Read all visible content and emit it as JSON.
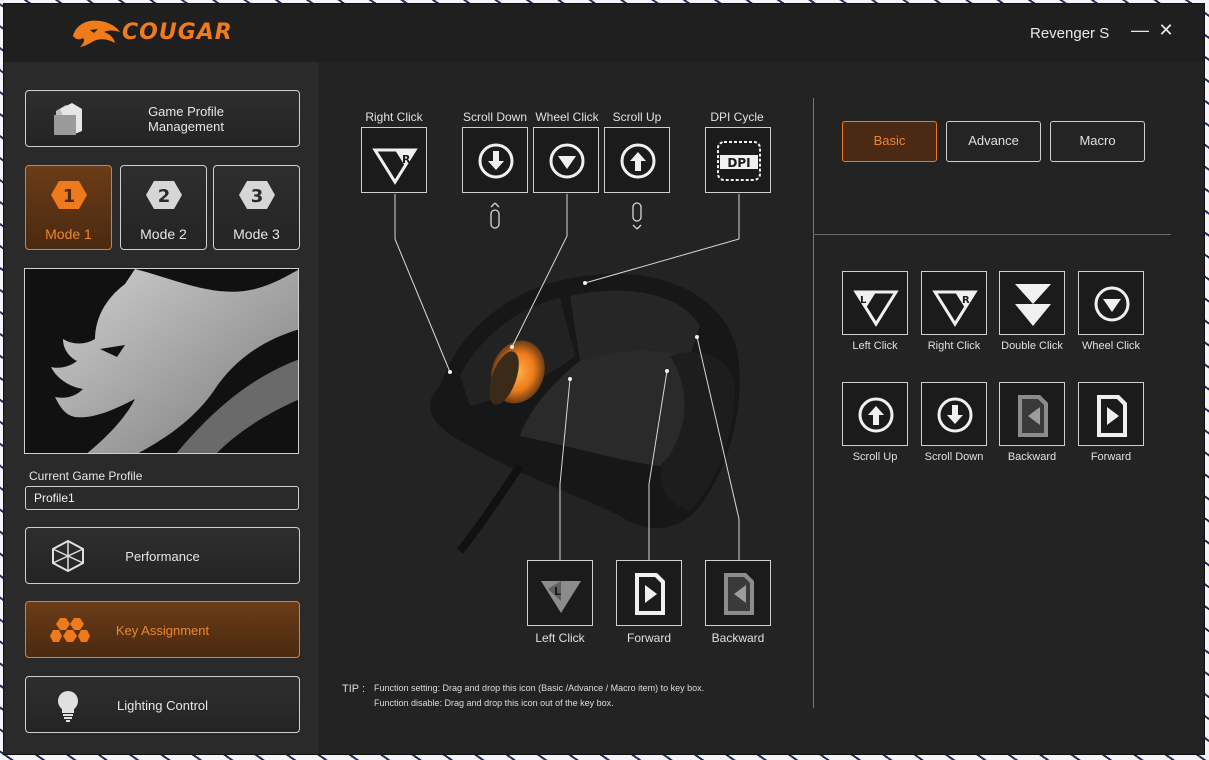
{
  "app": {
    "brand": "COUGAR",
    "device": "Revenger S",
    "minimize_glyph": "—",
    "close_glyph": "✕"
  },
  "sidebar": {
    "profile_mgmt_label": "Game Profile Management",
    "modes": [
      {
        "num": "1",
        "label": "Mode 1",
        "active": true
      },
      {
        "num": "2",
        "label": "Mode 2",
        "active": false
      },
      {
        "num": "3",
        "label": "Mode 3",
        "active": false
      }
    ],
    "current_profile_label": "Current Game Profile",
    "current_profile_value": "Profile1",
    "menu": [
      {
        "label": "Performance",
        "icon": "hexagon-cube-icon",
        "active": false
      },
      {
        "label": "Key Assignment",
        "icon": "honeycomb-icon",
        "active": true
      },
      {
        "label": "Lighting Control",
        "icon": "bulb-icon",
        "active": false
      }
    ]
  },
  "keys": {
    "right_click": "Right Click",
    "scroll_down": "Scroll Down",
    "wheel_click": "Wheel Click",
    "scroll_up": "Scroll Up",
    "dpi_cycle": "DPI Cycle",
    "dpi_text": "DPI",
    "left_click": "Left Click",
    "forward": "Forward",
    "backward": "Backward"
  },
  "tip": {
    "prefix": "TIP :",
    "line1": "Function setting: Drag and drop this icon (Basic /Advance / Macro item) to key box.",
    "line2": "Function disable: Drag and drop this icon out of the key box."
  },
  "tabs": {
    "basic": "Basic",
    "advance": "Advance",
    "macro": "Macro"
  },
  "functions": {
    "left_click": "Left Click",
    "right_click": "Right Click",
    "double_click": "Double Click",
    "wheel_click": "Wheel Click",
    "scroll_up": "Scroll Up",
    "scroll_down": "Scroll Down",
    "backward": "Backward",
    "forward": "Forward"
  },
  "colors": {
    "accent": "#ee7a1b",
    "panel": "#2a2a2a",
    "main": "#232323"
  }
}
